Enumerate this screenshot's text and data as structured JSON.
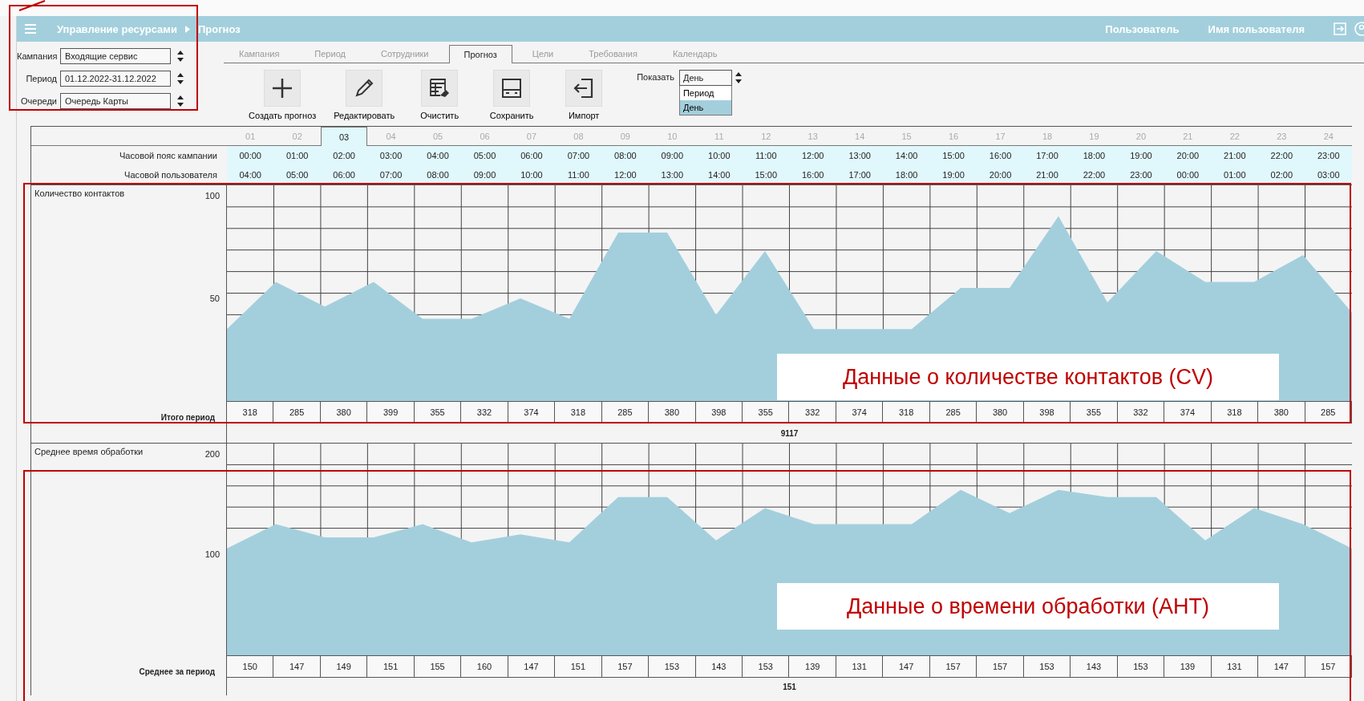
{
  "header": {
    "breadcrumb": [
      "Управление ресурсами",
      "Прогноз"
    ],
    "user_label": "Пользователь",
    "user_name": "Имя пользователя"
  },
  "filters": [
    {
      "label": "Кампания",
      "value": "Входящие сервис"
    },
    {
      "label": "Период",
      "value": "01.12.2022-31.12.2022"
    },
    {
      "label": "Очереди",
      "value": "Очередь Карты"
    }
  ],
  "tabs": [
    {
      "label": "Кампания",
      "selected": false
    },
    {
      "label": "Период",
      "selected": false
    },
    {
      "label": "Сотрудники",
      "selected": false
    },
    {
      "label": "Прогноз",
      "selected": true
    },
    {
      "label": "Цели",
      "selected": false
    },
    {
      "label": "Требования",
      "selected": false
    },
    {
      "label": "Календарь",
      "selected": false
    }
  ],
  "toolbar": [
    {
      "label": "Создать прогноз",
      "kind": "plus"
    },
    {
      "label": "Редактировать",
      "kind": "pencil"
    },
    {
      "label": "Очистить",
      "kind": "sheet"
    },
    {
      "label": "Сохранить",
      "kind": "save"
    },
    {
      "label": "Импорт",
      "kind": "import"
    }
  ],
  "show": {
    "label": "Показать",
    "value": "День",
    "options": [
      {
        "label": "Период",
        "selected": false
      },
      {
        "label": "День",
        "selected": true
      }
    ]
  },
  "days": [
    {
      "label": "01",
      "selected": false
    },
    {
      "label": "02",
      "selected": false
    },
    {
      "label": "03",
      "selected": true
    },
    {
      "label": "04",
      "selected": false
    },
    {
      "label": "05",
      "selected": false
    },
    {
      "label": "06",
      "selected": false
    },
    {
      "label": "07",
      "selected": false
    },
    {
      "label": "08",
      "selected": false
    },
    {
      "label": "09",
      "selected": false
    },
    {
      "label": "10",
      "selected": false
    },
    {
      "label": "11",
      "selected": false
    },
    {
      "label": "12",
      "selected": false
    },
    {
      "label": "13",
      "selected": false
    },
    {
      "label": "14",
      "selected": false
    },
    {
      "label": "15",
      "selected": false
    },
    {
      "label": "16",
      "selected": false
    },
    {
      "label": "17",
      "selected": false
    },
    {
      "label": "18",
      "selected": false
    },
    {
      "label": "19",
      "selected": false
    },
    {
      "label": "20",
      "selected": false
    },
    {
      "label": "21",
      "selected": false
    },
    {
      "label": "22",
      "selected": false
    },
    {
      "label": "23",
      "selected": false
    },
    {
      "label": "24",
      "selected": false
    }
  ],
  "timezone_rows": [
    {
      "label": "Часовой пояс кампании",
      "values": [
        "00:00",
        "01:00",
        "02:00",
        "03:00",
        "04:00",
        "05:00",
        "06:00",
        "07:00",
        "08:00",
        "09:00",
        "10:00",
        "11:00",
        "12:00",
        "13:00",
        "14:00",
        "15:00",
        "16:00",
        "17:00",
        "18:00",
        "19:00",
        "20:00",
        "21:00",
        "22:00",
        "23:00"
      ]
    },
    {
      "label": "Часовой пользователя",
      "values": [
        "04:00",
        "05:00",
        "06:00",
        "07:00",
        "08:00",
        "09:00",
        "10:00",
        "11:00",
        "12:00",
        "13:00",
        "14:00",
        "15:00",
        "16:00",
        "17:00",
        "18:00",
        "19:00",
        "20:00",
        "21:00",
        "22:00",
        "23:00",
        "00:00",
        "01:00",
        "02:00",
        "03:00"
      ]
    }
  ],
  "panels": [
    {
      "title": "Количество контактов",
      "chart_data": {
        "type": "area",
        "ylim": [
          0,
          105
        ],
        "yticks": [
          50,
          100
        ],
        "grid": true,
        "series": [
          {
            "color": "#a3cfdd",
            "values": [
              35,
              58,
              46,
              58,
              40,
              40,
              50,
              40,
              82,
              82,
              42,
              73,
              35,
              35,
              35,
              55,
              55,
              90,
              48,
              73,
              58,
              58,
              71,
              43
            ]
          }
        ]
      },
      "total_label": "Итого период",
      "totals": [
        "318",
        "285",
        "380",
        "399",
        "355",
        "332",
        "374",
        "318",
        "285",
        "380",
        "398",
        "355",
        "332",
        "374",
        "318",
        "285",
        "380",
        "398",
        "355",
        "332",
        "374",
        "318",
        "380",
        "285"
      ],
      "sum": "9117"
    },
    {
      "title": "Среднее время обработки",
      "chart_data": {
        "type": "area",
        "ylim": [
          0,
          210
        ],
        "yticks": [
          100,
          200
        ],
        "grid": true,
        "series": [
          {
            "color": "#a3cfdd",
            "values": [
              106,
              130,
              117,
              117,
              130,
              112,
              120,
              112,
              157,
              157,
              114,
              146,
              130,
              130,
              130,
              164,
              141,
              164,
              157,
              157,
              114,
              146,
              130,
              106
            ]
          }
        ]
      },
      "total_label": "Среднее за период",
      "totals": [
        "150",
        "147",
        "149",
        "151",
        "155",
        "160",
        "147",
        "151",
        "157",
        "153",
        "143",
        "153",
        "139",
        "131",
        "147",
        "157",
        "157",
        "153",
        "143",
        "153",
        "139",
        "131",
        "147",
        "157"
      ],
      "sum": "151"
    }
  ],
  "annotations": [
    {
      "text": "Данные о количестве контактов (CV)"
    },
    {
      "text": "Данные о времени обработки (АНТ)"
    }
  ]
}
